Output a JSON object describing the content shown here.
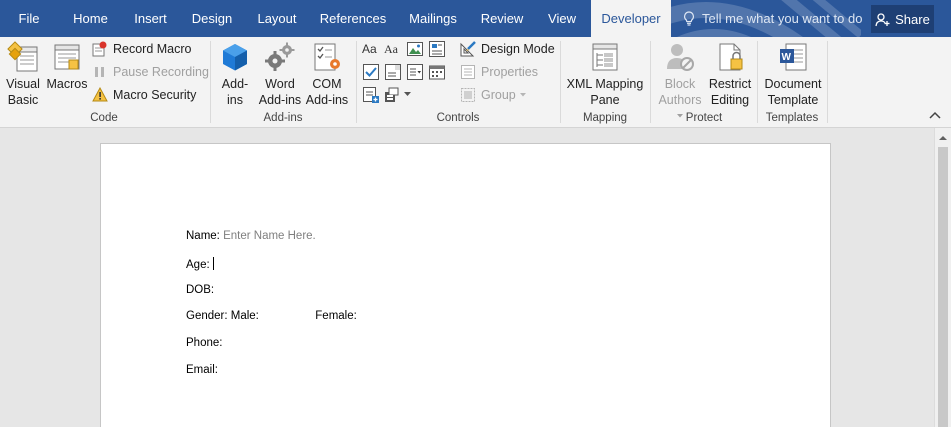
{
  "tabs": [
    {
      "label": "File"
    },
    {
      "label": "Home"
    },
    {
      "label": "Insert"
    },
    {
      "label": "Design"
    },
    {
      "label": "Layout"
    },
    {
      "label": "References"
    },
    {
      "label": "Mailings"
    },
    {
      "label": "Review"
    },
    {
      "label": "View"
    },
    {
      "label": "Developer"
    }
  ],
  "active_tab": "Developer",
  "tell_me": "Tell me what you want to do",
  "share_label": "Share",
  "ribbon": {
    "code": {
      "group_label": "Code",
      "visual_basic": [
        "Visual",
        "Basic"
      ],
      "macros": "Macros",
      "record_macro": "Record Macro",
      "pause_recording": "Pause Recording",
      "macro_security": "Macro Security"
    },
    "addins": {
      "group_label": "Add-ins",
      "addins": [
        "Add-",
        "ins"
      ],
      "word_addins": [
        "Word",
        "Add-ins"
      ],
      "com_addins": [
        "COM",
        "Add-ins"
      ]
    },
    "controls": {
      "group_label": "Controls",
      "design_mode": "Design Mode",
      "properties": "Properties",
      "group": "Group"
    },
    "mapping": {
      "group_label": "Mapping",
      "xml_pane": [
        "XML Mapping",
        "Pane"
      ]
    },
    "protect": {
      "group_label": "Protect",
      "block_authors": [
        "Block",
        "Authors"
      ],
      "restrict_editing": [
        "Restrict",
        "Editing"
      ]
    },
    "templates": {
      "group_label": "Templates",
      "document_template": [
        "Document",
        "Template"
      ]
    }
  },
  "colors": {
    "title_bar": "#2b579a",
    "ribbon_bg": "#f3f3f3",
    "doc_bg": "#e6e6e6"
  },
  "document": {
    "name_label": "Name:",
    "name_placeholder": "Enter Name Here.",
    "age_label": "Age:",
    "dob_label": "DOB:",
    "gender_label": "Gender: Male:",
    "female_label": "Female:",
    "phone_label": "Phone:",
    "email_label": "Email:"
  }
}
